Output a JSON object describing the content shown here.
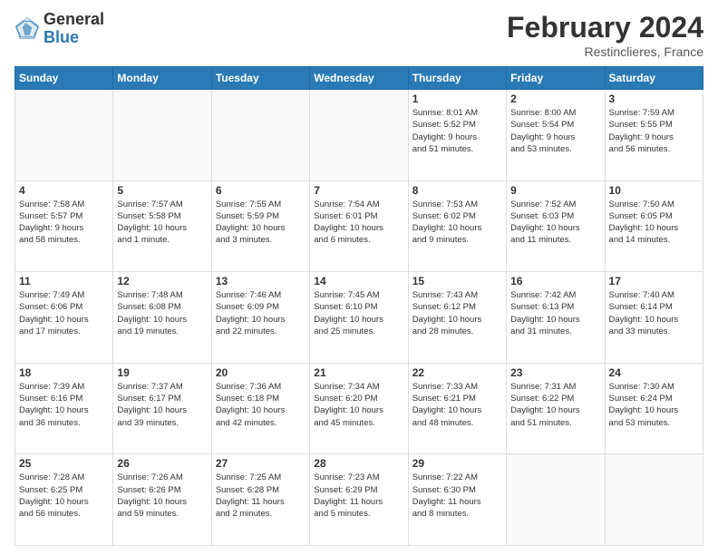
{
  "header": {
    "logo_general": "General",
    "logo_blue": "Blue",
    "title": "February 2024",
    "location": "Restinclieres, France"
  },
  "days_of_week": [
    "Sunday",
    "Monday",
    "Tuesday",
    "Wednesday",
    "Thursday",
    "Friday",
    "Saturday"
  ],
  "weeks": [
    [
      {
        "day": "",
        "info": ""
      },
      {
        "day": "",
        "info": ""
      },
      {
        "day": "",
        "info": ""
      },
      {
        "day": "",
        "info": ""
      },
      {
        "day": "1",
        "info": "Sunrise: 8:01 AM\nSunset: 5:52 PM\nDaylight: 9 hours\nand 51 minutes."
      },
      {
        "day": "2",
        "info": "Sunrise: 8:00 AM\nSunset: 5:54 PM\nDaylight: 9 hours\nand 53 minutes."
      },
      {
        "day": "3",
        "info": "Sunrise: 7:59 AM\nSunset: 5:55 PM\nDaylight: 9 hours\nand 56 minutes."
      }
    ],
    [
      {
        "day": "4",
        "info": "Sunrise: 7:58 AM\nSunset: 5:57 PM\nDaylight: 9 hours\nand 58 minutes."
      },
      {
        "day": "5",
        "info": "Sunrise: 7:57 AM\nSunset: 5:58 PM\nDaylight: 10 hours\nand 1 minute."
      },
      {
        "day": "6",
        "info": "Sunrise: 7:55 AM\nSunset: 5:59 PM\nDaylight: 10 hours\nand 3 minutes."
      },
      {
        "day": "7",
        "info": "Sunrise: 7:54 AM\nSunset: 6:01 PM\nDaylight: 10 hours\nand 6 minutes."
      },
      {
        "day": "8",
        "info": "Sunrise: 7:53 AM\nSunset: 6:02 PM\nDaylight: 10 hours\nand 9 minutes."
      },
      {
        "day": "9",
        "info": "Sunrise: 7:52 AM\nSunset: 6:03 PM\nDaylight: 10 hours\nand 11 minutes."
      },
      {
        "day": "10",
        "info": "Sunrise: 7:50 AM\nSunset: 6:05 PM\nDaylight: 10 hours\nand 14 minutes."
      }
    ],
    [
      {
        "day": "11",
        "info": "Sunrise: 7:49 AM\nSunset: 6:06 PM\nDaylight: 10 hours\nand 17 minutes."
      },
      {
        "day": "12",
        "info": "Sunrise: 7:48 AM\nSunset: 6:08 PM\nDaylight: 10 hours\nand 19 minutes."
      },
      {
        "day": "13",
        "info": "Sunrise: 7:46 AM\nSunset: 6:09 PM\nDaylight: 10 hours\nand 22 minutes."
      },
      {
        "day": "14",
        "info": "Sunrise: 7:45 AM\nSunset: 6:10 PM\nDaylight: 10 hours\nand 25 minutes."
      },
      {
        "day": "15",
        "info": "Sunrise: 7:43 AM\nSunset: 6:12 PM\nDaylight: 10 hours\nand 28 minutes."
      },
      {
        "day": "16",
        "info": "Sunrise: 7:42 AM\nSunset: 6:13 PM\nDaylight: 10 hours\nand 31 minutes."
      },
      {
        "day": "17",
        "info": "Sunrise: 7:40 AM\nSunset: 6:14 PM\nDaylight: 10 hours\nand 33 minutes."
      }
    ],
    [
      {
        "day": "18",
        "info": "Sunrise: 7:39 AM\nSunset: 6:16 PM\nDaylight: 10 hours\nand 36 minutes."
      },
      {
        "day": "19",
        "info": "Sunrise: 7:37 AM\nSunset: 6:17 PM\nDaylight: 10 hours\nand 39 minutes."
      },
      {
        "day": "20",
        "info": "Sunrise: 7:36 AM\nSunset: 6:18 PM\nDaylight: 10 hours\nand 42 minutes."
      },
      {
        "day": "21",
        "info": "Sunrise: 7:34 AM\nSunset: 6:20 PM\nDaylight: 10 hours\nand 45 minutes."
      },
      {
        "day": "22",
        "info": "Sunrise: 7:33 AM\nSunset: 6:21 PM\nDaylight: 10 hours\nand 48 minutes."
      },
      {
        "day": "23",
        "info": "Sunrise: 7:31 AM\nSunset: 6:22 PM\nDaylight: 10 hours\nand 51 minutes."
      },
      {
        "day": "24",
        "info": "Sunrise: 7:30 AM\nSunset: 6:24 PM\nDaylight: 10 hours\nand 53 minutes."
      }
    ],
    [
      {
        "day": "25",
        "info": "Sunrise: 7:28 AM\nSunset: 6:25 PM\nDaylight: 10 hours\nand 56 minutes."
      },
      {
        "day": "26",
        "info": "Sunrise: 7:26 AM\nSunset: 6:26 PM\nDaylight: 10 hours\nand 59 minutes."
      },
      {
        "day": "27",
        "info": "Sunrise: 7:25 AM\nSunset: 6:28 PM\nDaylight: 11 hours\nand 2 minutes."
      },
      {
        "day": "28",
        "info": "Sunrise: 7:23 AM\nSunset: 6:29 PM\nDaylight: 11 hours\nand 5 minutes."
      },
      {
        "day": "29",
        "info": "Sunrise: 7:22 AM\nSunset: 6:30 PM\nDaylight: 11 hours\nand 8 minutes."
      },
      {
        "day": "",
        "info": ""
      },
      {
        "day": "",
        "info": ""
      }
    ]
  ]
}
